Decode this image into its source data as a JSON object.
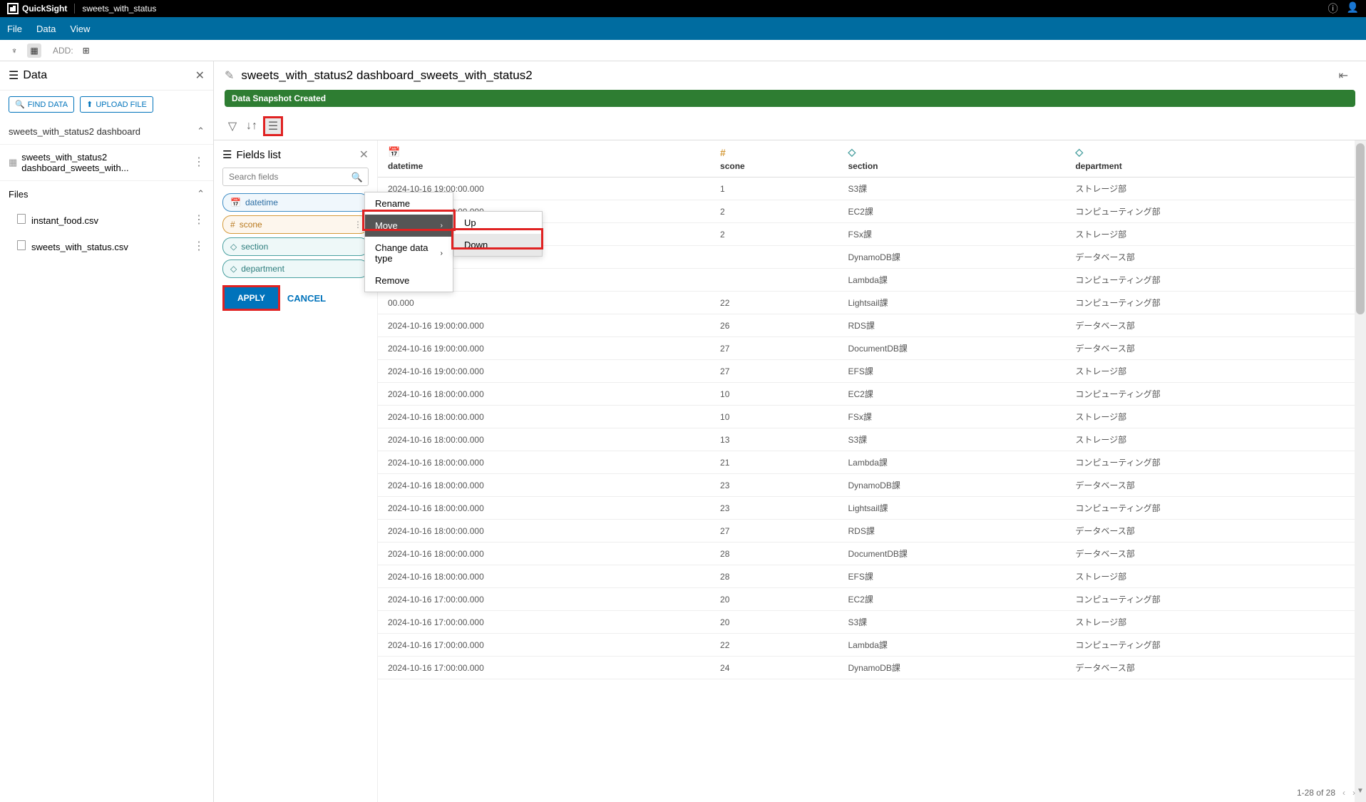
{
  "app": {
    "name": "QuickSight",
    "project": "sweets_with_status"
  },
  "menu": {
    "file": "File",
    "data": "Data",
    "view": "View"
  },
  "toolbar": {
    "add": "ADD:"
  },
  "sidebar": {
    "title": "Data",
    "find": "FIND DATA",
    "upload": "UPLOAD FILE",
    "dataset": "sweets_with_status2 dashboard",
    "dataset_long": "sweets_with_status2 dashboard_sweets_with...",
    "files_label": "Files",
    "files": [
      "instant_food.csv",
      "sweets_with_status.csv"
    ]
  },
  "content": {
    "title": "sweets_with_status2 dashboard_sweets_with_status2",
    "snapshot": "Data Snapshot Created",
    "fields_title": "Fields list",
    "search_placeholder": "Search fields",
    "fields": {
      "datetime": "datetime",
      "scone": "scone",
      "section": "section",
      "department": "department"
    },
    "apply": "APPLY",
    "cancel": "CANCEL"
  },
  "context": {
    "rename": "Rename",
    "move": "Move",
    "change_type": "Change data type",
    "remove": "Remove",
    "up": "Up",
    "down": "Down"
  },
  "table": {
    "headers": {
      "datetime": "datetime",
      "scone": "scone",
      "section": "section",
      "department": "department"
    },
    "rows": [
      {
        "dt": "2024-10-16 19:00:00.000",
        "sc": "1",
        "se": "S3課",
        "de": "ストレージ部"
      },
      {
        "dt": "2024-10-16 19:00:00.000",
        "sc": "2",
        "se": "EC2課",
        "de": "コンピューティング部"
      },
      {
        "dt": "00.000",
        "sc": "2",
        "se": "FSx課",
        "de": "ストレージ部"
      },
      {
        "dt": "",
        "sc": "",
        "se": "DynamoDB課",
        "de": "データベース部"
      },
      {
        "dt": "",
        "sc": "",
        "se": "Lambda課",
        "de": "コンピューティング部"
      },
      {
        "dt": "00.000",
        "sc": "22",
        "se": "Lightsail課",
        "de": "コンピューティング部"
      },
      {
        "dt": "2024-10-16 19:00:00.000",
        "sc": "26",
        "se": "RDS課",
        "de": "データベース部"
      },
      {
        "dt": "2024-10-16 19:00:00.000",
        "sc": "27",
        "se": "DocumentDB課",
        "de": "データベース部"
      },
      {
        "dt": "2024-10-16 19:00:00.000",
        "sc": "27",
        "se": "EFS課",
        "de": "ストレージ部"
      },
      {
        "dt": "2024-10-16 18:00:00.000",
        "sc": "10",
        "se": "EC2課",
        "de": "コンピューティング部"
      },
      {
        "dt": "2024-10-16 18:00:00.000",
        "sc": "10",
        "se": "FSx課",
        "de": "ストレージ部"
      },
      {
        "dt": "2024-10-16 18:00:00.000",
        "sc": "13",
        "se": "S3課",
        "de": "ストレージ部"
      },
      {
        "dt": "2024-10-16 18:00:00.000",
        "sc": "21",
        "se": "Lambda課",
        "de": "コンピューティング部"
      },
      {
        "dt": "2024-10-16 18:00:00.000",
        "sc": "23",
        "se": "DynamoDB課",
        "de": "データベース部"
      },
      {
        "dt": "2024-10-16 18:00:00.000",
        "sc": "23",
        "se": "Lightsail課",
        "de": "コンピューティング部"
      },
      {
        "dt": "2024-10-16 18:00:00.000",
        "sc": "27",
        "se": "RDS課",
        "de": "データベース部"
      },
      {
        "dt": "2024-10-16 18:00:00.000",
        "sc": "28",
        "se": "DocumentDB課",
        "de": "データベース部"
      },
      {
        "dt": "2024-10-16 18:00:00.000",
        "sc": "28",
        "se": "EFS課",
        "de": "ストレージ部"
      },
      {
        "dt": "2024-10-16 17:00:00.000",
        "sc": "20",
        "se": "EC2課",
        "de": "コンピューティング部"
      },
      {
        "dt": "2024-10-16 17:00:00.000",
        "sc": "20",
        "se": "S3課",
        "de": "ストレージ部"
      },
      {
        "dt": "2024-10-16 17:00:00.000",
        "sc": "22",
        "se": "Lambda課",
        "de": "コンピューティング部"
      },
      {
        "dt": "2024-10-16 17:00:00.000",
        "sc": "24",
        "se": "DynamoDB課",
        "de": "データベース部"
      }
    ]
  },
  "pagination": {
    "text": "1-28 of 28"
  }
}
